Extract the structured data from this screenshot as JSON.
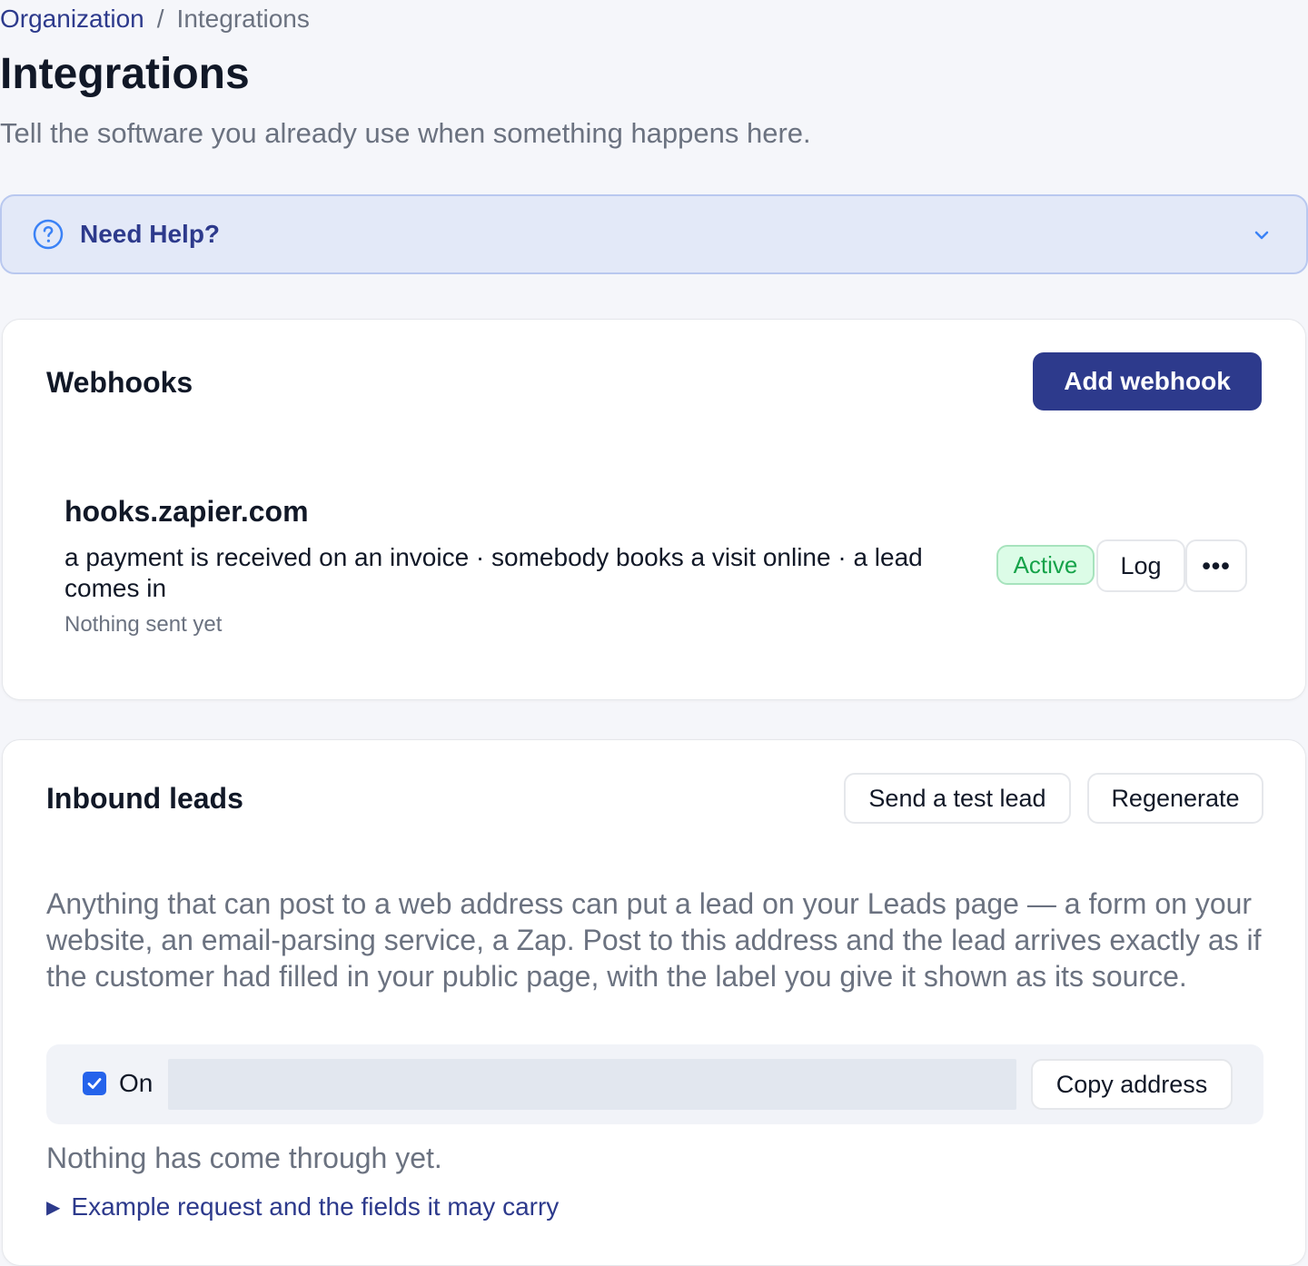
{
  "breadcrumb": {
    "parent": "Organization",
    "separator": "/",
    "current": "Integrations"
  },
  "page": {
    "title": "Integrations",
    "subtitle": "Tell the software you already use when something happens here."
  },
  "help": {
    "title": "Need Help?",
    "icon": "question-circle-icon",
    "toggle_icon": "chevron-down-icon"
  },
  "webhooks": {
    "title": "Webhooks",
    "add_button": "Add webhook",
    "items": [
      {
        "host": "hooks.zapier.com",
        "events": "a payment is received on an invoice · somebody books a visit online · a lead comes in",
        "status_text": "Nothing sent yet",
        "badge": "Active",
        "log_button": "Log",
        "more_button": "•••"
      }
    ]
  },
  "inbound": {
    "title": "Inbound leads",
    "test_button": "Send a test lead",
    "regenerate_button": "Regenerate",
    "description": "Anything that can post to a web address can put a lead on your Leads page — a form on your website, an email-parsing service, a Zap. Post to this address and the lead arrives exactly as if the customer had filled in your public page, with the label you give it shown as its source.",
    "enabled": true,
    "on_label": "On",
    "address_value": "",
    "copy_button": "Copy address",
    "empty_state": "Nothing has come through yet.",
    "example_toggle": "Example request and the fields it may carry"
  },
  "colors": {
    "accent": "#2d3a8c",
    "page_bg": "#f5f6fa",
    "help_bg": "#e3e9f8",
    "active_bg": "#dcfce7",
    "active_text": "#16a34a",
    "checkbox": "#2563eb"
  }
}
